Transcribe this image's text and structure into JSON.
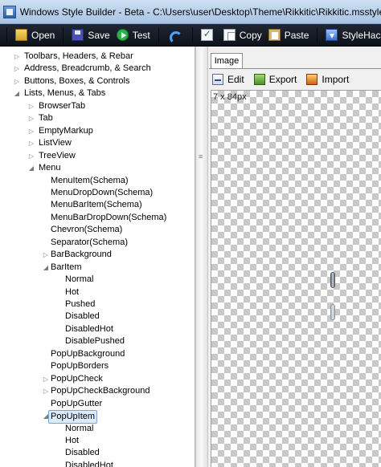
{
  "window": {
    "title": "Windows Style Builder - Beta - C:\\Users\\user\\Desktop\\Theme\\Rikkitic\\Rikkitic.msstyles"
  },
  "toolbar": {
    "open": "Open",
    "save": "Save",
    "test": "Test",
    "copy": "Copy",
    "paste": "Paste",
    "stylehacks": "StyleHacks"
  },
  "tree": [
    {
      "label": "Toolbars, Headers, & Rebar",
      "expander": "▷"
    },
    {
      "label": "Address, Breadcrumb, & Search",
      "expander": "▷"
    },
    {
      "label": "Buttons, Boxes, & Controls",
      "expander": "▷"
    },
    {
      "label": "Lists, Menus, & Tabs",
      "expander": "◢"
    },
    {
      "label": "BrowserTab",
      "expander": "▷"
    },
    {
      "label": "Tab",
      "expander": "▷"
    },
    {
      "label": "EmptyMarkup",
      "expander": "▷"
    },
    {
      "label": "ListView",
      "expander": "▷"
    },
    {
      "label": "TreeView",
      "expander": "▷"
    },
    {
      "label": "Menu",
      "expander": "◢"
    },
    {
      "label": "MenuItem(Schema)",
      "expander": ""
    },
    {
      "label": "MenuDropDown(Schema)",
      "expander": ""
    },
    {
      "label": "MenuBarItem(Schema)",
      "expander": ""
    },
    {
      "label": "MenuBarDropDown(Schema)",
      "expander": ""
    },
    {
      "label": "Chevron(Schema)",
      "expander": ""
    },
    {
      "label": "Separator(Schema)",
      "expander": ""
    },
    {
      "label": "BarBackground",
      "expander": "▷"
    },
    {
      "label": "BarItem",
      "expander": "◢"
    },
    {
      "label": "Normal",
      "expander": ""
    },
    {
      "label": "Hot",
      "expander": ""
    },
    {
      "label": "Pushed",
      "expander": ""
    },
    {
      "label": "Disabled",
      "expander": ""
    },
    {
      "label": "DisabledHot",
      "expander": ""
    },
    {
      "label": "DisablePushed",
      "expander": ""
    },
    {
      "label": "PopUpBackground",
      "expander": ""
    },
    {
      "label": "PopUpBorders",
      "expander": ""
    },
    {
      "label": "PopUpCheck",
      "expander": "▷"
    },
    {
      "label": "PopUpCheckBackground",
      "expander": "▷"
    },
    {
      "label": "PopUpGutter",
      "expander": ""
    },
    {
      "label": "PopUpItem",
      "expander": "◢"
    },
    {
      "label": "Normal",
      "expander": ""
    },
    {
      "label": "Hot",
      "expander": ""
    },
    {
      "label": "Disabled",
      "expander": ""
    },
    {
      "label": "DisabledHot",
      "expander": ""
    }
  ],
  "right": {
    "tab": "Image",
    "edit": "Edit",
    "export": "Export",
    "import": "Import",
    "size": "7 x 84px"
  }
}
